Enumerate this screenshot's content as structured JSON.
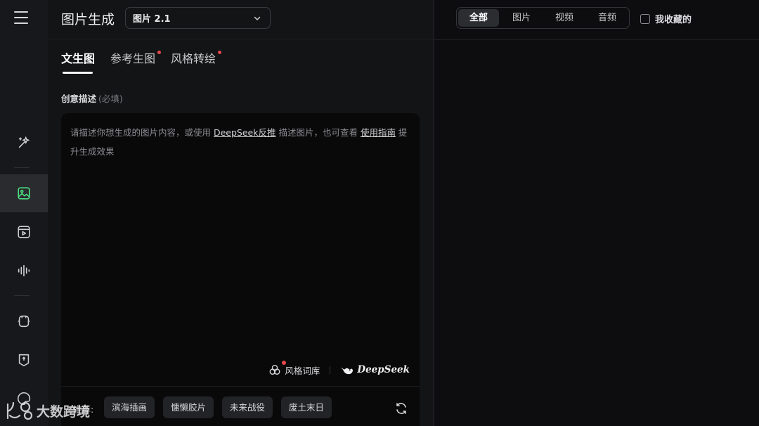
{
  "header": {
    "title": "图片生成",
    "model_select": {
      "value": "图片 2.1",
      "icon": "chevron-down-icon"
    }
  },
  "rail": {
    "menu_icon": "hamburger-icon",
    "items": [
      {
        "icon": "magic-wand-icon",
        "active": false
      },
      {
        "icon": "image-icon",
        "active": true
      },
      {
        "icon": "video-icon",
        "active": false
      },
      {
        "icon": "audio-wave-icon",
        "active": false
      },
      {
        "icon": "robot-icon",
        "active": false
      },
      {
        "icon": "brush-icon",
        "active": false
      },
      {
        "icon": "palette-icon",
        "active": false
      }
    ]
  },
  "tabs": [
    {
      "label": "文生图",
      "active": true,
      "badge": false
    },
    {
      "label": "参考生图",
      "active": false,
      "badge": true
    },
    {
      "label": "风格转绘",
      "active": false,
      "badge": true
    }
  ],
  "prompt": {
    "label": "创意描述",
    "label_hint": "(必填)",
    "placeholder_part1": "请描述你想生成的图片内容，或使用 ",
    "link_deepseek": "DeepSeek反推",
    "placeholder_part2": " 描述图片，也可查看 ",
    "link_guide": "使用指南",
    "placeholder_part3": " 提升生成效果"
  },
  "tools": {
    "style_library": "风格词库",
    "deepseek": "DeepSeek"
  },
  "recommend": {
    "label": "推荐:",
    "chips": [
      "滨海插画",
      "慵懒胶片",
      "未来战役",
      "废土末日"
    ],
    "refresh_icon": "refresh-icon"
  },
  "filter": {
    "segments": [
      {
        "label": "全部",
        "active": true
      },
      {
        "label": "图片",
        "active": false
      },
      {
        "label": "视频",
        "active": false
      },
      {
        "label": "音频",
        "active": false
      }
    ],
    "favorites_label": "我收藏的",
    "favorites_checked": false
  },
  "watermark": {
    "text": "大数跨境"
  },
  "colors": {
    "accent_active": "#4ade80",
    "badge_dot": "#e5484d"
  }
}
